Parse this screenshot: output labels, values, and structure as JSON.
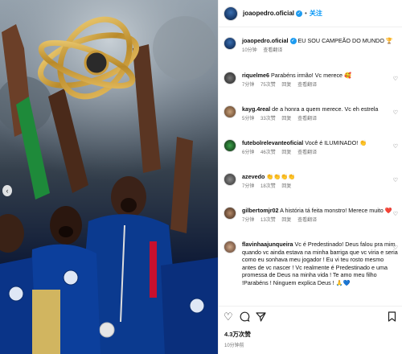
{
  "post": {
    "username": "joaopedro.oficial",
    "follow_label": "关注",
    "caption_user": "joaopedro.oficial",
    "caption_text": "EU SOU CAMPEÃO DO MUNDO 🏆",
    "caption_time": "10分钟",
    "caption_translate": "查看翻译"
  },
  "comments": [
    {
      "user": "riquelme6",
      "text": "Parabéns irmão! Vc merece 🥰",
      "time": "7分钟",
      "likes": "75次赞",
      "reply": "回复",
      "translate": "查看翻译"
    },
    {
      "user": "kayg.4real",
      "text": "de a honra a quem merece. Vc eh estrela",
      "time": "5分钟",
      "likes": "33次赞",
      "reply": "回复",
      "translate": "查看翻译"
    },
    {
      "user": "futebolrelevanteoficial",
      "text": "Você é ILUMINADO! 👏",
      "time": "6分钟",
      "likes": "46次赞",
      "reply": "回复",
      "translate": "查看翻译"
    },
    {
      "user": "azevedo",
      "text": "👏👏👏👏",
      "time": "7分钟",
      "likes": "18次赞",
      "reply": "回复",
      "translate": ""
    },
    {
      "user": "gilbertomjr02",
      "text": "A história tá feita monstro! Merece muito ❤️",
      "time": "7分钟",
      "likes": "13次赞",
      "reply": "回复",
      "translate": "查看翻译"
    },
    {
      "user": "flavinhaajunqueira",
      "text": "Vc é Predestinado! Deus falou pra mim quando vc ainda estava na minha barriga que vc viria e seria como eu sonhava meu jogador ! Eu vi teu rosto mesmo antes de vc nascer ! Vc realmente é Predestinado e uma promessa de Deus na minha vida ! Te amo meu filho !Parabéns ! Ninguem explica Deus ! 🙏💙",
      "time": "",
      "likes": "",
      "reply": "",
      "translate": ""
    }
  ],
  "footer": {
    "likes": "4.3万次赞",
    "time_ago": "10分钟前"
  },
  "icons": {
    "like": "heart-icon",
    "comment": "comment-icon",
    "share": "share-icon",
    "save": "bookmark-icon",
    "prev": "chevron-left-icon"
  },
  "colors": {
    "follow": "#0095f6",
    "verified": "#1d9bf0",
    "jersey": "#0b3a8f"
  }
}
